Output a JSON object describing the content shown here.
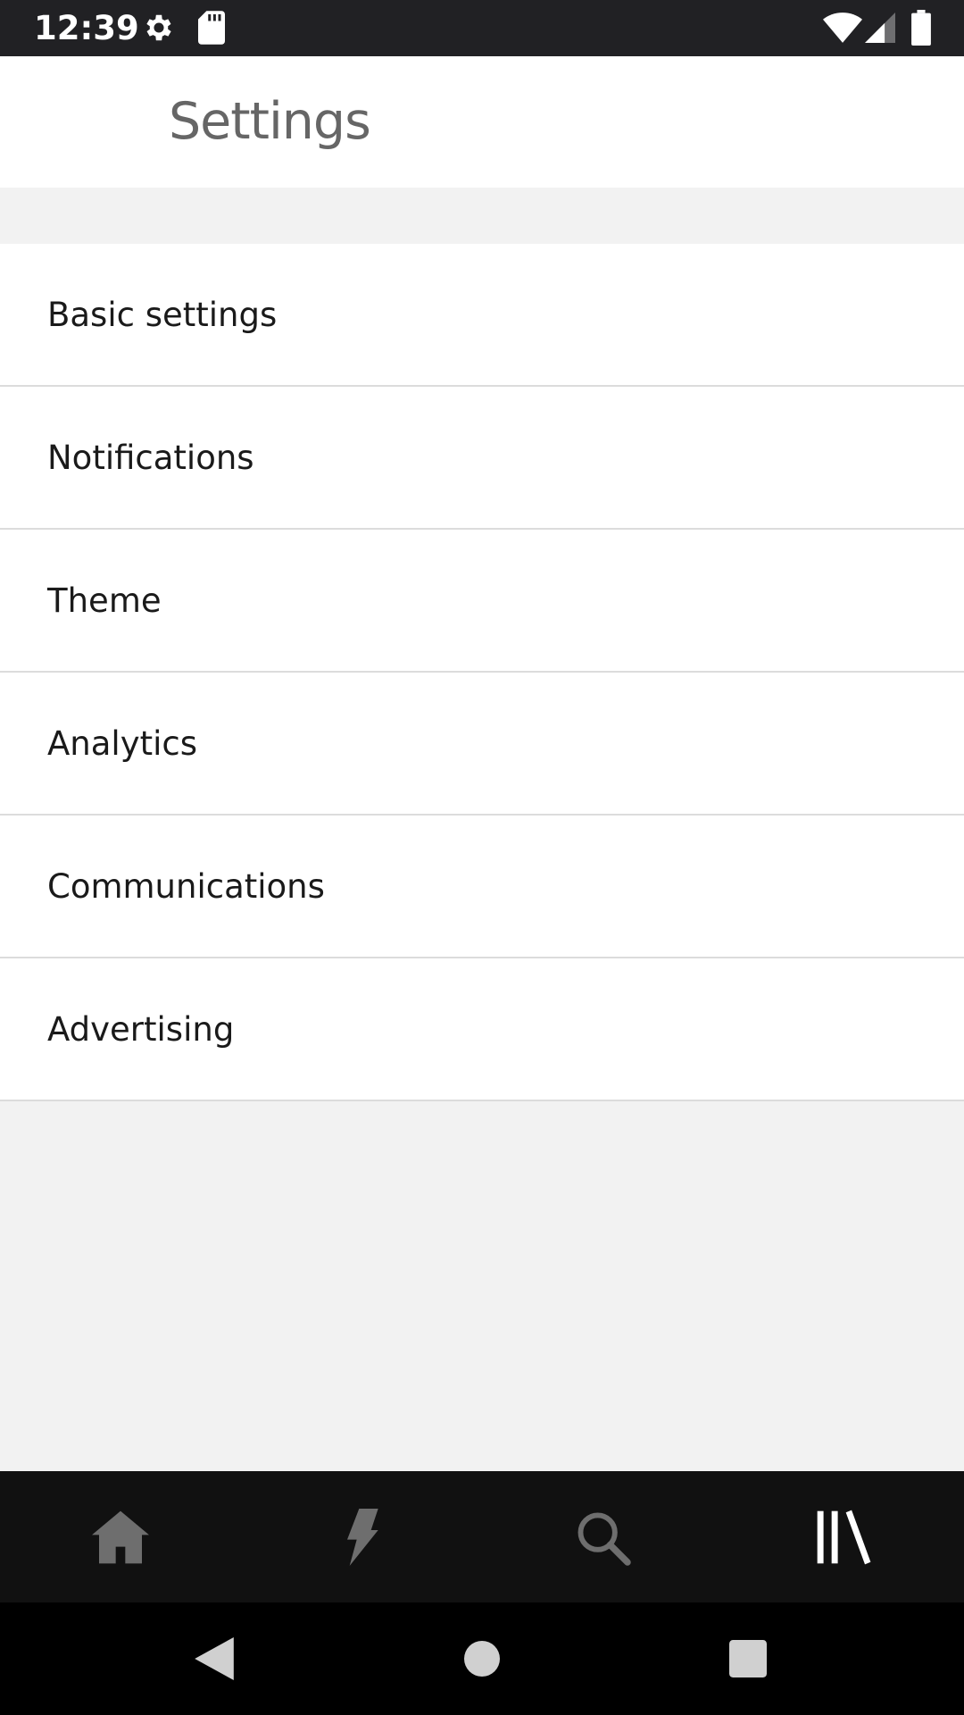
{
  "status_bar": {
    "time": "12:39",
    "icons": [
      "settings-icon",
      "sd-card-icon",
      "wifi-icon",
      "cell-signal-icon",
      "battery-icon"
    ]
  },
  "header": {
    "title": "Settings"
  },
  "settings_list": {
    "items": [
      {
        "label": "Basic settings"
      },
      {
        "label": "Notifications"
      },
      {
        "label": "Theme"
      },
      {
        "label": "Analytics"
      },
      {
        "label": "Communications"
      },
      {
        "label": "Advertising"
      }
    ]
  },
  "bottom_nav": {
    "items": [
      {
        "icon": "home-icon",
        "active": false
      },
      {
        "icon": "lightning-icon",
        "active": false
      },
      {
        "icon": "search-icon",
        "active": false
      },
      {
        "icon": "library-icon",
        "active": true
      }
    ]
  },
  "system_nav": {
    "items": [
      "back-icon",
      "home-circle-icon",
      "recents-icon"
    ]
  },
  "colors": {
    "status_bar_bg": "#212124",
    "page_bg": "#f2f2f2",
    "bottom_nav_bg": "#111111",
    "icon_inactive": "#6e6e6e",
    "icon_active": "#ffffff"
  }
}
